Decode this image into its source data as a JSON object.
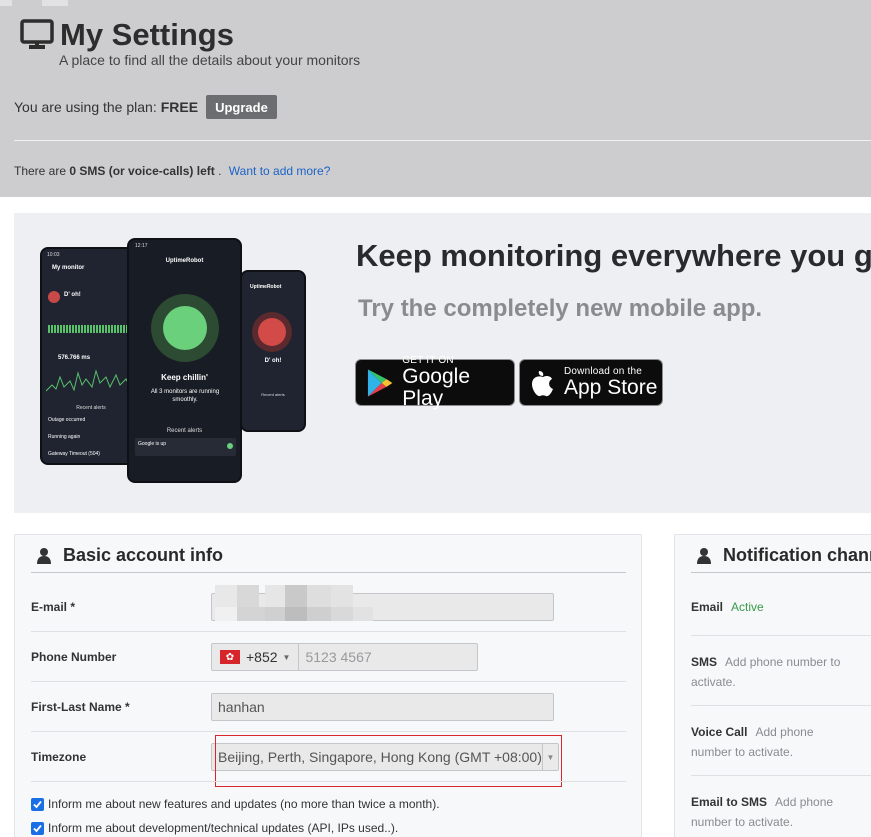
{
  "header": {
    "title": "My Settings",
    "subtitle": "A place to find all the details about your monitors",
    "plan_text": "You are using the plan:",
    "plan_name": "FREE",
    "upgrade_label": "Upgrade",
    "sms_prefix": "There are",
    "sms_count": "0 SMS (or voice-calls) left",
    "sms_suffix": ".",
    "sms_link": "Want to add more?"
  },
  "promo": {
    "title": "Keep monitoring everywhere you go",
    "subtitle": "Try the completely new mobile app.",
    "google_play": {
      "small": "GET IT ON",
      "big": "Google Play"
    },
    "app_store": {
      "small": "Download on the",
      "big": "App Store"
    },
    "phone_left": {
      "time": "10:03",
      "title": "My monitor",
      "status": "D' oh!",
      "response": "576.766 ms",
      "alerts_header": "Recent alerts",
      "alerts": [
        "Outage occurred",
        "Running again",
        "Gateway Timeout (504)"
      ]
    },
    "phone_center": {
      "time": "12:17",
      "brand": "UptimeRobot",
      "status": "Keep chillin'",
      "monitors_text": "All 3 monitors are running smoothly.",
      "alerts_header": "Recent alerts",
      "alert": "Google is up"
    },
    "phone_right": {
      "brand": "UptimeRobot",
      "status": "D' oh!",
      "alerts_header": "Recent alerts"
    }
  },
  "account": {
    "heading": "Basic account info",
    "email_label": "E-mail *",
    "email_value": "",
    "phone_label": "Phone Number",
    "phone_dial": "+852",
    "phone_placeholder": "5123 4567",
    "name_label": "First-Last Name *",
    "name_value": "hanhan",
    "timezone_label": "Timezone",
    "timezone_value": "Beijing, Perth, Singapore, Hong Kong (GMT +08:00)",
    "checkbox_features": "Inform me about new features and updates (no more than twice a month).",
    "checkbox_dev": "Inform me about development/technical updates (API, IPs used..)."
  },
  "notifications": {
    "heading": "Notification channels",
    "email": {
      "label": "Email",
      "status": "Active"
    },
    "sms": {
      "label": "SMS",
      "status": "Add phone number to activate."
    },
    "voice": {
      "label": "Voice Call",
      "status": "Add phone number to activate."
    },
    "email_to_sms": {
      "label": "Email to SMS",
      "status": "Add phone number to activate."
    }
  },
  "colors": {
    "header_bg": "#cdcdcf",
    "link": "#1d63c7",
    "active": "#3a9a4a",
    "highlight": "#d9262c",
    "checkbox": "#1b6fe6"
  }
}
